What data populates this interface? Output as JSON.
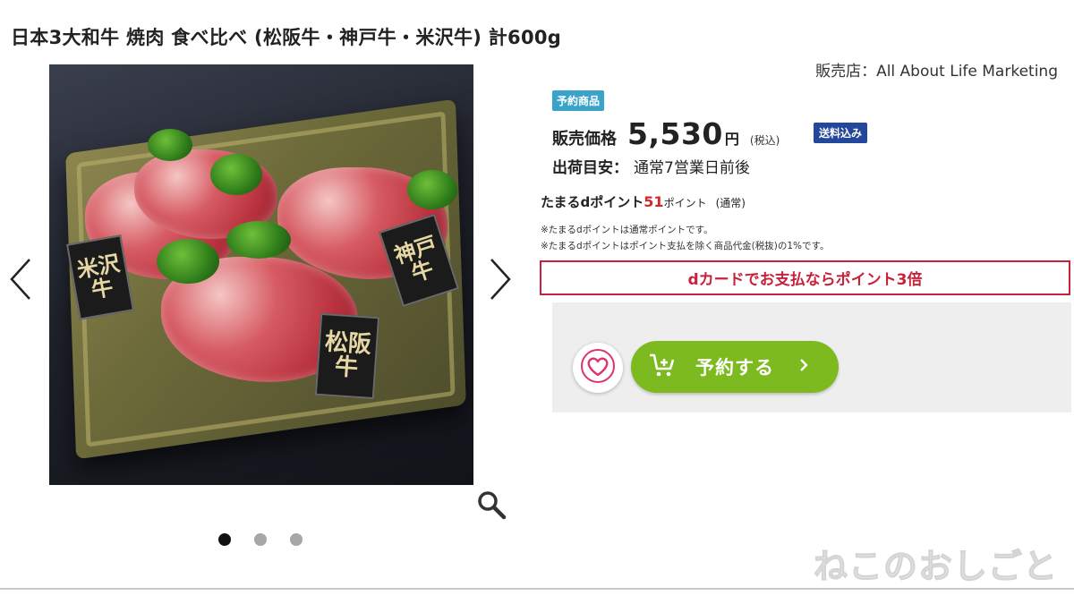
{
  "product": {
    "title": "日本3大和牛 焼肉 食べ比べ (松阪牛・神戸牛・米沢牛) 計600g"
  },
  "gallery": {
    "brand_cards": [
      "米沢牛",
      "松阪牛",
      "神戸牛"
    ],
    "slide_count": 3,
    "active_slide": 1,
    "icons": {
      "prev": "chevron-left-icon",
      "next": "chevron-right-icon",
      "zoom": "magnifier-icon"
    }
  },
  "seller": {
    "text": "販売店：All About Life Marketing"
  },
  "badges": {
    "preorder": "予約商品",
    "shipping": "送料込み"
  },
  "price": {
    "label": "販売価格",
    "value": "5,530",
    "unit": "円",
    "tax_note": "(税込)"
  },
  "shipping": {
    "label": "出荷目安：",
    "value": "通常7営業日前後"
  },
  "points": {
    "label": "たまるdポイント",
    "value": "51",
    "unit": "ポイント",
    "type": "(通常)",
    "note1": "※たまるdポイントは通常ポイントです。",
    "note2": "※たまるdポイントはポイント支払を除く商品代金(税抜)の1%です。"
  },
  "promo": {
    "dcard": "dカードでお支払ならポイント3倍"
  },
  "actions": {
    "reserve_label": "予約する",
    "icons": {
      "favorite": "heart-icon",
      "cart": "cart-add-icon",
      "chevron": "chevron-right-icon"
    }
  },
  "watermark": "ねこのおしごと",
  "colors": {
    "preorder_badge": "#3aa3c9",
    "shipping_badge": "#23479a",
    "points_accent": "#d12727",
    "dcard_accent": "#c8213a",
    "reserve_button": "#7cba1f",
    "favorite_accent": "#e0336e"
  }
}
